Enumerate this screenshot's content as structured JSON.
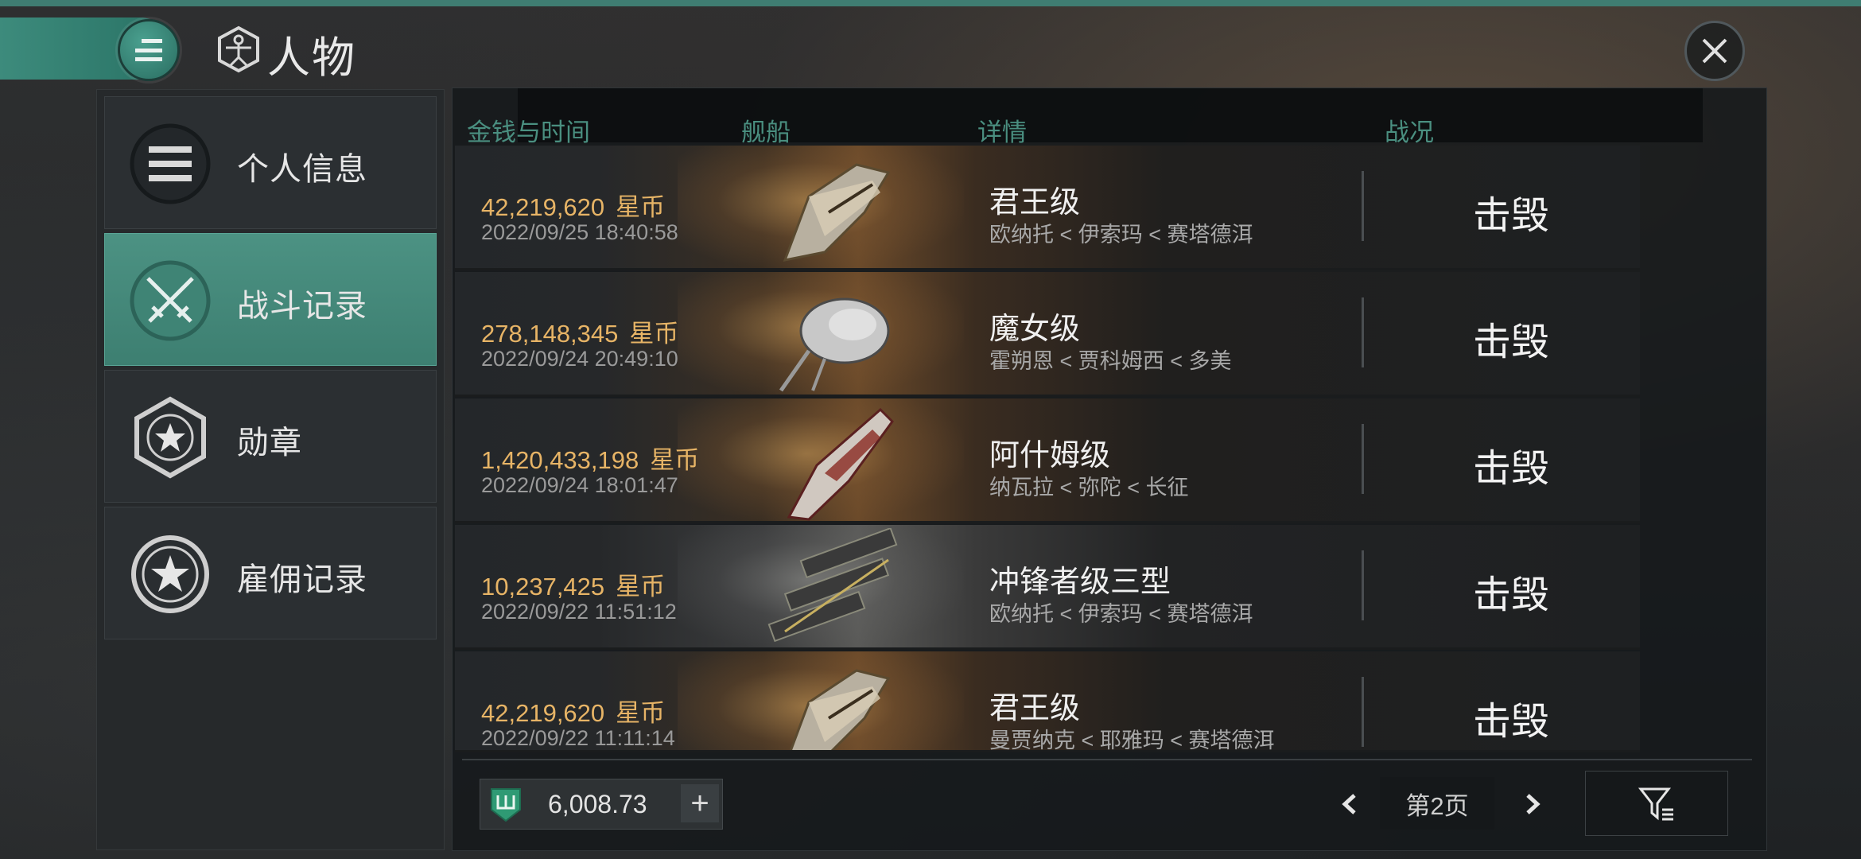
{
  "header": {
    "title": "人物"
  },
  "sidebar": {
    "items": [
      {
        "label": "个人信息",
        "icon": "list-icon",
        "active": false
      },
      {
        "label": "战斗记录",
        "icon": "crossed-swords-icon",
        "active": true
      },
      {
        "label": "勋章",
        "icon": "star-hexagon-icon",
        "active": false
      },
      {
        "label": "雇佣记录",
        "icon": "star-circle-icon",
        "active": false
      }
    ]
  },
  "table": {
    "columns": [
      "金钱与时间",
      "舰船",
      "详情",
      "战况"
    ],
    "currency": "星币",
    "rows": [
      {
        "price": "42,219,620",
        "date": "2022/09/25  18:40:58",
        "ship": "君王级",
        "route": "欧纳托 < 伊索玛 < 赛塔德洱",
        "status": "击毁"
      },
      {
        "price": "278,148,345",
        "date": "2022/09/24  20:49:10",
        "ship": "魔女级",
        "route": "霍朔恩 < 贾科姆西 < 多美",
        "status": "击毁"
      },
      {
        "price": "1,420,433,198",
        "date": "2022/09/24  18:01:47",
        "ship": "阿什姆级",
        "route": "纳瓦拉 < 弥陀 < 长征",
        "status": "击毁"
      },
      {
        "price": "10,237,425",
        "date": "2022/09/22  11:51:12",
        "ship": "冲锋者级三型",
        "route": "欧纳托 < 伊索玛 < 赛塔德洱",
        "status": "击毁"
      },
      {
        "price": "42,219,620",
        "date": "2022/09/22  11:11:14",
        "ship": "君王级",
        "route": "曼贾纳克 < 耶雅玛 < 赛塔德洱",
        "status": "击毁"
      }
    ]
  },
  "footer": {
    "wallet_value": "6,008.73",
    "wallet_plus": "+",
    "page_label": "第2页"
  },
  "colors": {
    "accent": "#3d8b7c",
    "price": "#e7b466",
    "header_text": "#4a8f80"
  }
}
